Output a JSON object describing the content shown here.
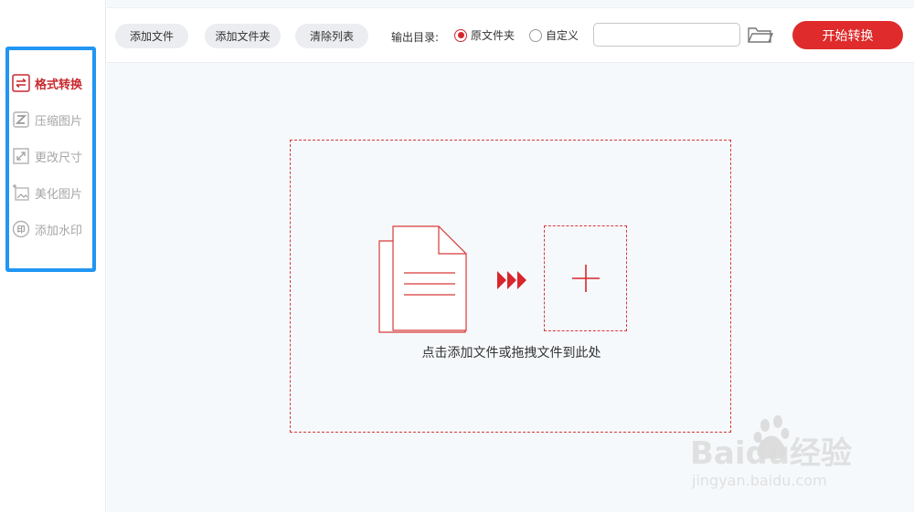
{
  "sidebar": {
    "items": [
      {
        "label": "格式转换",
        "icon": "swap-arrows-icon",
        "active": true
      },
      {
        "label": "压缩图片",
        "icon": "compress-icon",
        "active": false
      },
      {
        "label": "更改尺寸",
        "icon": "resize-icon",
        "active": false
      },
      {
        "label": "美化图片",
        "icon": "beautify-icon",
        "active": false
      },
      {
        "label": "添加水印",
        "icon": "stamp-icon",
        "active": false
      }
    ]
  },
  "toolbar": {
    "add_file": "添加文件",
    "add_folder": "添加文件夹",
    "clear_list": "清除列表",
    "output_label": "输出目录:",
    "radio_original": "原文件夹",
    "radio_custom": "自定义",
    "path_value": "",
    "start": "开始转换"
  },
  "dropzone": {
    "hint": "点击添加文件或拖拽文件到此处"
  },
  "watermark": {
    "brand": "Baidu经验",
    "url": "jingyan.baidu.com"
  },
  "colors": {
    "accent": "#df2b2b",
    "highlight": "#2196f3",
    "inactive": "#a6a6a6"
  }
}
